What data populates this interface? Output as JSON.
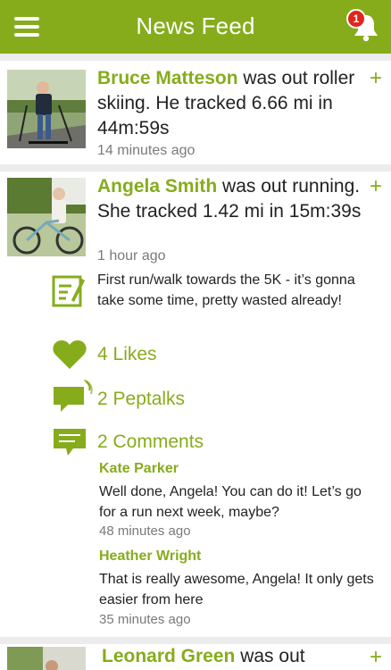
{
  "header": {
    "title": "News Feed",
    "notification_count": "1"
  },
  "feed": [
    {
      "name": "Bruce Matteson",
      "rest": " was out roller skiing. He tracked 6.66 mi in 44m:59s",
      "time": "14 minutes ago"
    },
    {
      "name": "Angela Smith",
      "rest": " was out running. She tracked 1.42 mi in 15m:39s",
      "time": "1 hour ago",
      "note": "First run/walk towards the 5K - it’s gonna take some time, pretty wasted already!",
      "likes": "4 Likes",
      "peptalks": "2 Peptalks",
      "comments_label": "2 Comments",
      "comments": [
        {
          "name": "Kate Parker",
          "text": "Well done, Angela! You can do it! Let’s go for a run next week, maybe?",
          "time": "48 minutes ago"
        },
        {
          "name": "Heather Wright",
          "text": "That is really awesome, Angela! It only gets easier from here",
          "time": "35 minutes ago"
        }
      ]
    },
    {
      "name": "Leonard Green",
      "rest": " was out"
    }
  ],
  "icons": {
    "menu": "hamburger-icon",
    "bell": "bell-icon",
    "add": "plus-icon",
    "note": "note-icon",
    "like": "heart-icon",
    "peptalk": "speech-bubble-sound-icon",
    "comment": "comment-bubble-icon"
  },
  "colors": {
    "accent": "#86ac1c",
    "badge": "#e0251c",
    "background": "#ececec"
  }
}
